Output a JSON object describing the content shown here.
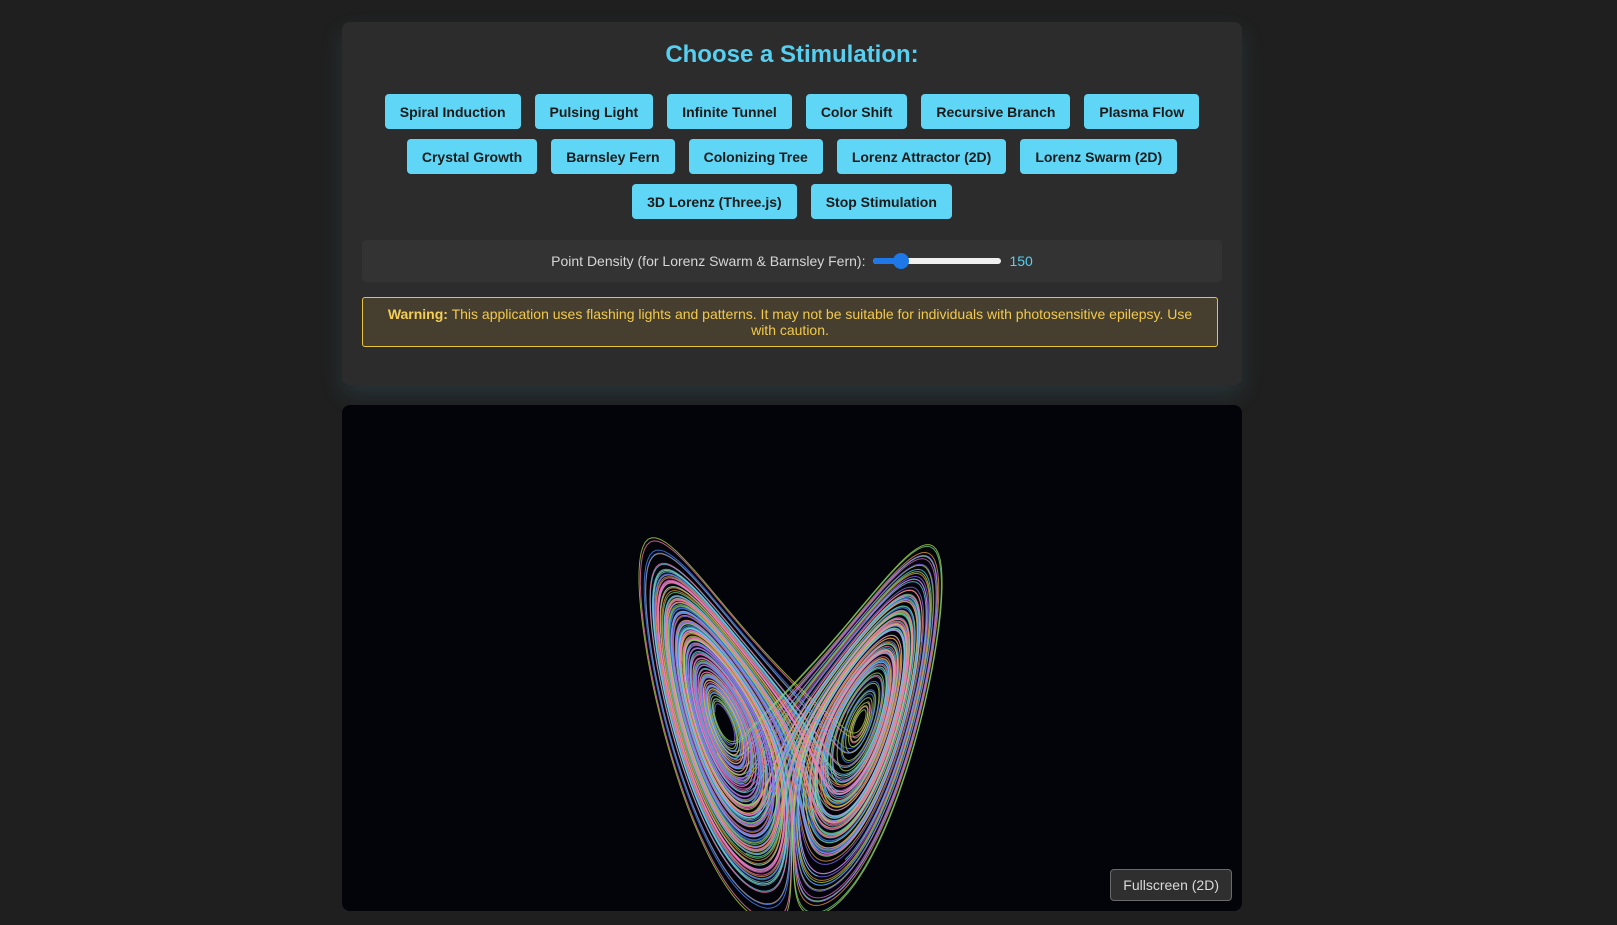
{
  "title": "Choose a Stimulation:",
  "buttons": {
    "row1": [
      "Spiral Induction",
      "Pulsing Light",
      "Infinite Tunnel",
      "Color Shift",
      "Recursive Branch",
      "Plasma Flow"
    ],
    "row2": [
      "Crystal Growth",
      "Barnsley Fern",
      "Colonizing Tree",
      "Lorenz Attractor (2D)",
      "Lorenz Swarm (2D)"
    ],
    "row3": [
      "3D Lorenz (Three.js)",
      "Stop Stimulation"
    ]
  },
  "density": {
    "label": "Point Density (for Lorenz Swarm & Barnsley Fern):",
    "value": "150",
    "fraction": 0.18
  },
  "warning": {
    "bold": "Warning:",
    "text": "This application uses flashing lights and patterns. It may not be suitable for individuals with photosensitive epilepsy. Use with caution."
  },
  "fullscreen_label": "Fullscreen (2D)",
  "colors": {
    "accent": "#5fd6f5",
    "warning_border": "#e9c43b",
    "canvas_bg": "#02040a",
    "trail_colors": [
      "#b8e04a",
      "#5dd6f0",
      "#e86ad8",
      "#8a6cff",
      "#f0a040",
      "#6fe08a",
      "#4e8cff",
      "#ff7ab0"
    ]
  }
}
